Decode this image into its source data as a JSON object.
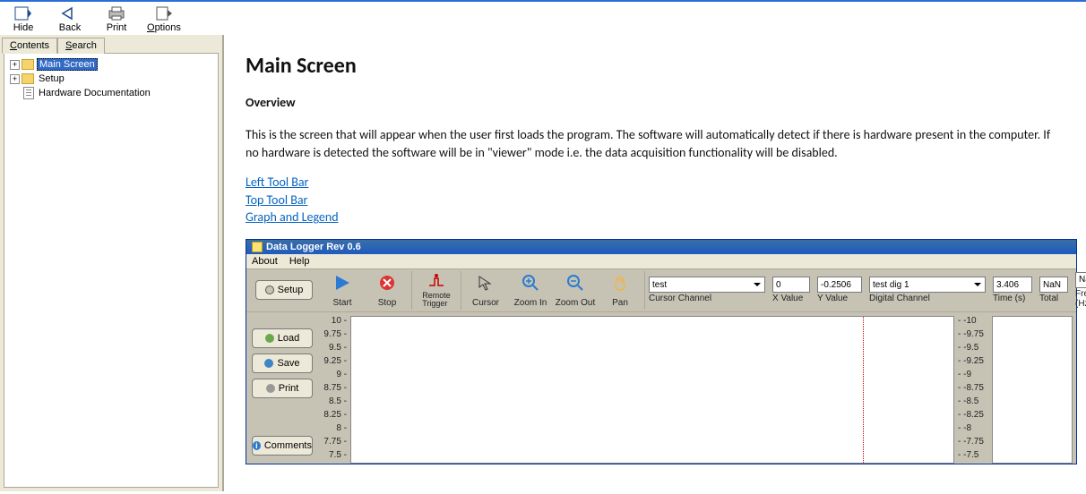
{
  "toolbar": {
    "hide": "Hide",
    "back": "Back",
    "print": "Print",
    "options": "Options"
  },
  "sidebar": {
    "tabs": {
      "contents": "Contents",
      "search": "Search"
    },
    "tree": {
      "main_screen": "Main Screen",
      "setup": "Setup",
      "hardware_doc": "Hardware Documentation"
    }
  },
  "page": {
    "title": "Main Screen",
    "overview_heading": "Overview",
    "overview_body": "This is the screen that will appear when the user first loads the program.  The software will automatically detect if there is hardware present in the computer.  If no hardware is detected the software will be in \"viewer\" mode i.e. the data acquisition functionality will be disabled.",
    "links": {
      "left_toolbar": "Left Tool Bar",
      "top_toolbar": "Top Tool Bar",
      "graph_legend": "Graph and Legend"
    }
  },
  "embed": {
    "title": "Data Logger Rev 0.6",
    "menu": {
      "about": "About",
      "help": "Help"
    },
    "side_buttons": {
      "setup": "Setup",
      "load": "Load",
      "save": "Save",
      "print": "Print",
      "comments": "Comments"
    },
    "top_buttons": {
      "start": "Start",
      "stop": "Stop",
      "remote_trigger": "Remote Trigger",
      "cursor": "Cursor",
      "zoom_in": "Zoom In",
      "zoom_out": "Zoom Out",
      "pan": "Pan"
    },
    "readouts": {
      "cursor_channel_value": "test",
      "cursor_channel_label": "Cursor Channel",
      "x_value": "0",
      "x_label": "X Value",
      "y_value": "-0.2506",
      "y_label": "Y Value",
      "digital_channel_value": "test dig 1",
      "digital_channel_label": "Digital Channel",
      "time_value": "3.406",
      "time_label": "Time (s)",
      "total_value": "NaN",
      "total_label": "Total",
      "freq_value": "NaN",
      "freq_label": "Freq (Hz)"
    },
    "y_ticks_left": [
      "10",
      "9.75",
      "9.5",
      "9.25",
      "9",
      "8.75",
      "8.5",
      "8.25",
      "8",
      "7.75",
      "7.5"
    ],
    "y_ticks_right": [
      "-10",
      "-9.75",
      "-9.5",
      "-9.25",
      "-9",
      "-8.75",
      "-8.5",
      "-8.25",
      "-8",
      "-7.75",
      "-7.5"
    ]
  }
}
